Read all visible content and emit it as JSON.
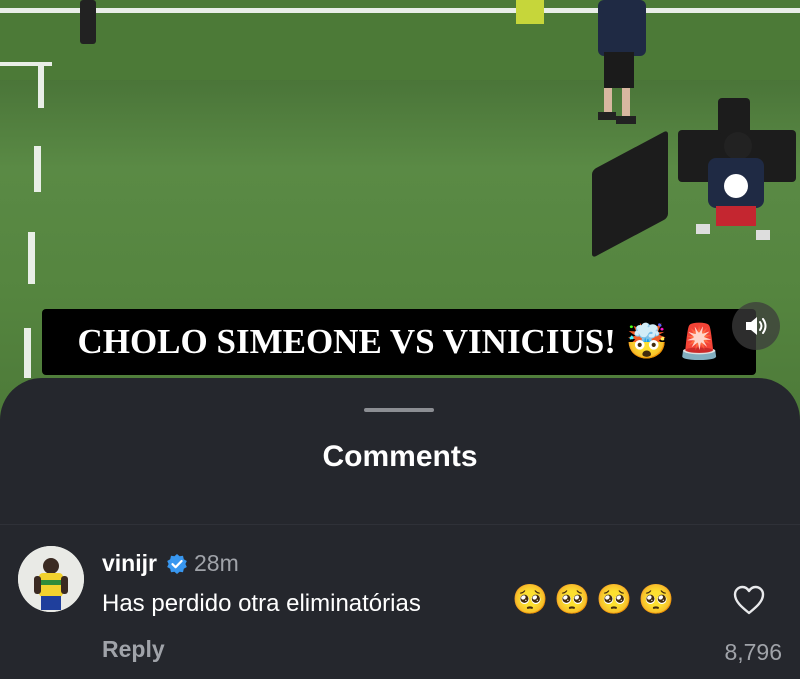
{
  "video": {
    "headline": "CHOLO SIMEONE VS VINICIUS!",
    "headline_emojis": [
      "🤯",
      "🚨"
    ]
  },
  "comments_sheet": {
    "title": "Comments",
    "comments": [
      {
        "username": "vinijr",
        "verified": true,
        "time": "28m",
        "text": "Has perdido otra eliminatórias",
        "emojis": [
          "🥺",
          "🥺",
          "🥺",
          "🥺"
        ],
        "reply_label": "Reply",
        "likes": "8,796"
      }
    ]
  },
  "colors": {
    "sheet_background": "#25272d",
    "verified_badge": "#3897f0",
    "secondary_text": "#a0a3a9"
  }
}
